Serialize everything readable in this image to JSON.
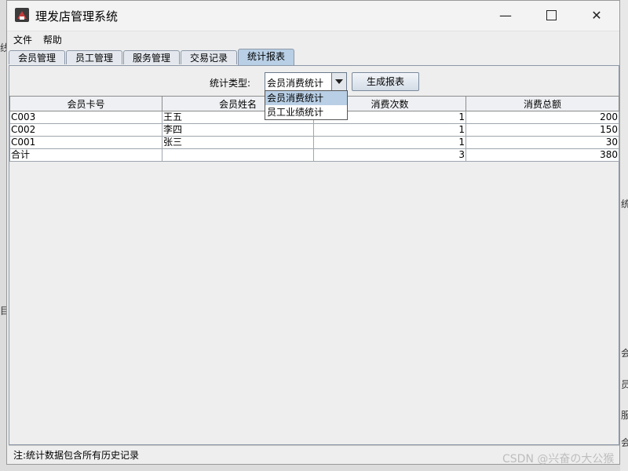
{
  "window": {
    "title": "理发店管理系统"
  },
  "window_controls": {
    "minimize": "—",
    "close": "✕"
  },
  "menu": [
    "文件",
    "帮助"
  ],
  "tabs": [
    "会员管理",
    "员工管理",
    "服务管理",
    "交易记录",
    "统计报表"
  ],
  "active_tab": "统计报表",
  "controls": {
    "type_label": "统计类型:",
    "type_selected": "会员消费统计",
    "generate_button": "生成报表"
  },
  "dropdown": {
    "options": [
      "会员消费统计",
      "员工业绩统计"
    ],
    "highlighted": "会员消费统计"
  },
  "table": {
    "columns": [
      "会员卡号",
      "会员姓名",
      "消费次数",
      "消费总额"
    ],
    "rows": [
      [
        "C003",
        "王五",
        "1",
        "200"
      ],
      [
        "C002",
        "李四",
        "1",
        "150"
      ],
      [
        "C001",
        "张三",
        "1",
        "30"
      ],
      [
        "合计",
        "",
        "3",
        "380"
      ]
    ]
  },
  "status": {
    "note": "注:统计数据包含所有历史记录"
  },
  "watermark": "CSDN @兴奋の大公猴",
  "background_fragments": [
    "统",
    "员",
    "会",
    "员",
    "服",
    "会",
    "目",
    "线"
  ],
  "colors": {
    "tab_active": "#b8cfe5",
    "selection": "#b8cfe5"
  }
}
